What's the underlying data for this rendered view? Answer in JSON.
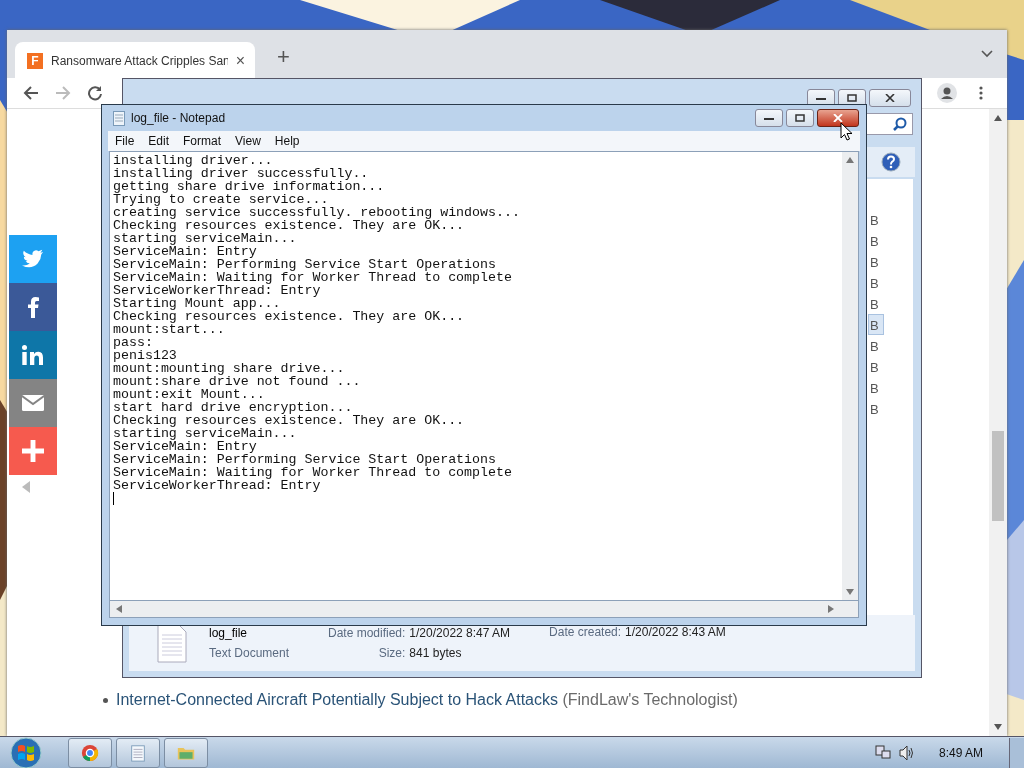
{
  "browser": {
    "tab": {
      "title": "Ransomware Attack Cripples San",
      "favicon": "F",
      "close": "×"
    },
    "new_tab": "+",
    "article": {
      "links": [
        {
          "title": "Internet-Connected Aircraft Potentially Subject to Hack Attacks",
          "source": "(FindLaw's Technologist)"
        }
      ]
    }
  },
  "share_buttons": [
    {
      "kind": "twitter",
      "color": "#1da1f2"
    },
    {
      "kind": "facebook",
      "color": "#3b5998"
    },
    {
      "kind": "linkedin",
      "color": "#0e76a8"
    },
    {
      "kind": "email",
      "color": "#848484"
    },
    {
      "kind": "more",
      "color": "#f65a4e"
    }
  ],
  "explorer": {
    "rows": [
      {
        "size": "B",
        "selected": false
      },
      {
        "size": "B",
        "selected": false
      },
      {
        "size": "B",
        "selected": false
      },
      {
        "size": "B",
        "selected": false
      },
      {
        "size": "B",
        "selected": false
      },
      {
        "size": "B",
        "selected": true
      },
      {
        "size": "B",
        "selected": false
      },
      {
        "size": "B",
        "selected": false
      },
      {
        "size": "B",
        "selected": false
      },
      {
        "size": "B",
        "selected": false
      }
    ],
    "details": {
      "name": "log_file",
      "type": "Text Document",
      "modified_label": "Date modified:",
      "modified": "1/20/2022 8:47 AM",
      "created_label": "Date created:",
      "created": "1/20/2022 8:43 AM",
      "size_label": "Size:",
      "size": "841 bytes"
    }
  },
  "notepad": {
    "title": "log_file - Notepad",
    "menu": [
      "File",
      "Edit",
      "Format",
      "View",
      "Help"
    ],
    "lines": [
      "installing driver...",
      "installing driver successfully..",
      "getting share drive information...",
      "Trying to create service...",
      "creating service successfully. rebooting windows...",
      "Checking resources existence. They are OK...",
      "starting serviceMain...",
      "ServiceMain: Entry",
      "ServiceMain: Performing Service Start Operations",
      "ServiceMain: Waiting for Worker Thread to complete",
      "ServiceWorkerThread: Entry",
      "Starting Mount app...",
      "Checking resources existence. They are OK...",
      "mount:start...",
      "pass:",
      "penis123",
      "mount:mounting share drive...",
      "mount:share drive not found ...",
      "mount:exit Mount...",
      "start hard drive encryption...",
      "Checking resources existence. They are OK...",
      "starting serviceMain...",
      "ServiceMain: Entry",
      "ServiceMain: Performing Service Start Operations",
      "ServiceMain: Waiting for Worker Thread to complete",
      "ServiceWorkerThread: Entry"
    ]
  },
  "taskbar": {
    "apps": [
      {
        "kind": "chrome"
      },
      {
        "kind": "notepad"
      },
      {
        "kind": "folder"
      }
    ],
    "clock": "8:49 AM"
  }
}
